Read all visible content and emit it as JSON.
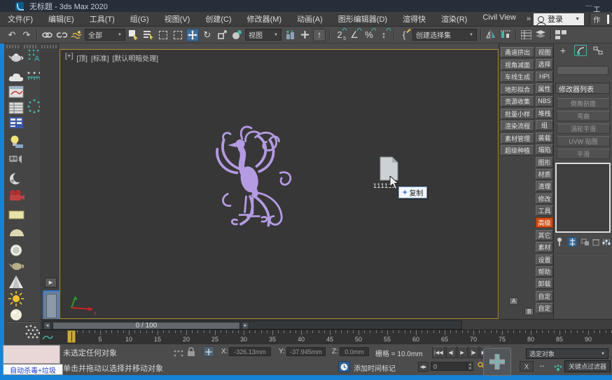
{
  "window": {
    "title": "无标题 - 3ds Max 2020",
    "minimize_glyph": "—"
  },
  "menubar": {
    "items": [
      "文件(F)",
      "编辑(E)",
      "工具(T)",
      "组(G)",
      "视图(V)",
      "创建(C)",
      "修改器(M)",
      "动画(A)",
      "图形编辑器(D)",
      "渲得快",
      "渲染(R)",
      "Civil View"
    ],
    "overflow_chevron": "»",
    "login_label": "登录",
    "workspace_label": "工作区:"
  },
  "toolbar": {
    "undo_glyph": "↶",
    "redo_glyph": "↷",
    "filter_dropdown": "全部",
    "rotate_glyph": "↻",
    "ref_coord_dropdown": "视图",
    "manipulate_glyph": "+",
    "kb_override_glyph": "↑",
    "snap_main": "2",
    "snap_sub": "5",
    "angle_glyph": "∠",
    "percent_glyph": "%",
    "spinner_glyph": "↕",
    "named_sets_glyph": "{",
    "selection_set_dropdown": "创建选择集",
    "dropdown_arrow": "▼"
  },
  "viewport": {
    "label_parts": [
      "[+]",
      "[顶]",
      "[标准]",
      "[默认明暗处理]"
    ],
    "drag_file_name": "111111",
    "drag_tooltip_plus": "+",
    "drag_tooltip_text": "复制",
    "axis_x_label": "x"
  },
  "plugin_panel": {
    "left_buttons": [
      "甬道挤出",
      "视角减面",
      "车线生成",
      "地形拟合",
      "资源收集",
      "批量小样",
      "渲染流程",
      "素材管理",
      "超级种植"
    ],
    "right_buttons": [
      {
        "label": "视图"
      },
      {
        "label": "选择"
      },
      {
        "label": "HPI"
      },
      {
        "label": "属性"
      },
      {
        "label": "NBS"
      },
      {
        "label": "堆栈"
      },
      {
        "label": "组"
      },
      {
        "label": "装载"
      },
      {
        "label": "塌陷"
      },
      {
        "label": "图形"
      },
      {
        "label": "材质"
      },
      {
        "label": "清理"
      },
      {
        "label": "修改"
      },
      {
        "label": "工具"
      },
      {
        "label": "高级",
        "cls": "active"
      },
      {
        "label": "其它"
      },
      {
        "label": "素材"
      },
      {
        "label": "设置"
      },
      {
        "label": "帮助"
      },
      {
        "label": "卸载"
      },
      {
        "label": "自定"
      },
      {
        "label": "自定"
      }
    ],
    "badge_a": "A",
    "badge_b": "B"
  },
  "command_panel": {
    "tab_plus_glyph": "+",
    "modifier_list_label": "修改器列表",
    "modifier_buttons": [
      "倒角剖面",
      "弯曲",
      "涡轮平滑",
      "UVW 贴图",
      "平滑"
    ]
  },
  "timeline": {
    "slider_value": "0 / 100",
    "prev_glyph": "◄",
    "next_glyph": "►",
    "start": 0,
    "end": 100,
    "label_step": 5,
    "current_frame": 0
  },
  "status_bar": {
    "selection_status": "未选定任何对象",
    "prompt": "单击并拖动以选择并移动对象",
    "x_label": "X:",
    "x_value": "-326.13mm",
    "y_label": "Y:",
    "y_value": "-37.945mm",
    "z_label": "Z:",
    "z_value": "0.0mm",
    "grid_label": "栅格 = 10.0mm",
    "playback": [
      "|◀◀",
      "◀|",
      "▶",
      "|▶",
      "▶▶|"
    ],
    "key_mode_glyph": "◀▶",
    "frame_field_value": "0",
    "spin_up": "▲",
    "spin_down": "▼",
    "time_tag_label": "添加时间标记",
    "selected_object_dropdown": "选定对象",
    "close_button": "X",
    "swap_glyph": "↔",
    "key_filters_label": "关键点过滤器"
  },
  "float_window": {
    "antivirus_label": "自动杀毒+垃圾"
  },
  "colors": {
    "accent_blue": "#1583d7",
    "active_orange": "#d05018",
    "viewport_border": "#b08b33",
    "phoenix_purple": "#b49be2",
    "selected_tool_blue": "#3d6d99"
  }
}
